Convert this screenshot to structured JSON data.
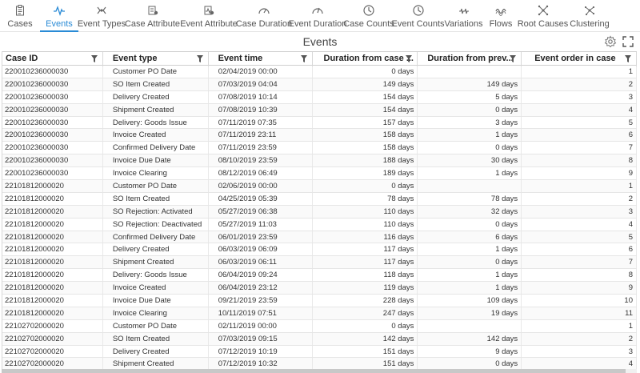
{
  "tabs": [
    {
      "label": "Cases",
      "icon": "clipboard-icon",
      "active": false
    },
    {
      "label": "Events",
      "icon": "pulse-icon",
      "active": true
    },
    {
      "label": "Event Types",
      "icon": "event-types-icon",
      "active": false
    },
    {
      "label": "Case Attribute",
      "icon": "case-attribute-icon",
      "active": false
    },
    {
      "label": "Event Attribute",
      "icon": "event-attribute-icon",
      "active": false
    },
    {
      "label": "Case Duration",
      "icon": "gauge-icon",
      "active": false
    },
    {
      "label": "Event Duration",
      "icon": "gauge-icon",
      "active": false
    },
    {
      "label": "Case Counts",
      "icon": "clock-icon",
      "active": false
    },
    {
      "label": "Event Counts",
      "icon": "clock-icon",
      "active": false
    },
    {
      "label": "Variations",
      "icon": "variations-icon",
      "active": false
    },
    {
      "label": "Flows",
      "icon": "flows-icon",
      "active": false
    },
    {
      "label": "Root Causes",
      "icon": "root-causes-icon",
      "active": false
    },
    {
      "label": "Clustering",
      "icon": "clustering-icon",
      "active": false
    }
  ],
  "page_title": "Events",
  "columns": [
    "Case ID",
    "Event type",
    "Event time",
    "Duration from case ...",
    "Duration from prev...",
    "Event order in case"
  ],
  "rows": [
    [
      "220010236000030",
      "Customer PO Date",
      "02/04/2019 00:00",
      "0 days",
      "",
      "1"
    ],
    [
      "220010236000030",
      "SO Item Created",
      "07/03/2019 04:04",
      "149 days",
      "149 days",
      "2"
    ],
    [
      "220010236000030",
      "Delivery Created",
      "07/08/2019 10:14",
      "154 days",
      "5 days",
      "3"
    ],
    [
      "220010236000030",
      "Shipment Created",
      "07/08/2019 10:39",
      "154 days",
      "0 days",
      "4"
    ],
    [
      "220010236000030",
      "Delivery: Goods Issue",
      "07/11/2019 07:35",
      "157 days",
      "3 days",
      "5"
    ],
    [
      "220010236000030",
      "Invoice Created",
      "07/11/2019 23:11",
      "158 days",
      "1 days",
      "6"
    ],
    [
      "220010236000030",
      "Confirmed Delivery Date",
      "07/11/2019 23:59",
      "158 days",
      "0 days",
      "7"
    ],
    [
      "220010236000030",
      "Invoice Due Date",
      "08/10/2019 23:59",
      "188 days",
      "30 days",
      "8"
    ],
    [
      "220010236000030",
      "Invoice Clearing",
      "08/12/2019 06:49",
      "189 days",
      "1 days",
      "9"
    ],
    [
      "22101812000020",
      "Customer PO Date",
      "02/06/2019 00:00",
      "0 days",
      "",
      "1"
    ],
    [
      "22101812000020",
      "SO Item Created",
      "04/25/2019 05:39",
      "78 days",
      "78 days",
      "2"
    ],
    [
      "22101812000020",
      "SO Rejection: Activated",
      "05/27/2019 06:38",
      "110 days",
      "32 days",
      "3"
    ],
    [
      "22101812000020",
      "SO Rejection: Deactivated",
      "05/27/2019 11:03",
      "110 days",
      "0 days",
      "4"
    ],
    [
      "22101812000020",
      "Confirmed Delivery Date",
      "06/01/2019 23:59",
      "116 days",
      "6 days",
      "5"
    ],
    [
      "22101812000020",
      "Delivery Created",
      "06/03/2019 06:09",
      "117 days",
      "1 days",
      "6"
    ],
    [
      "22101812000020",
      "Shipment Created",
      "06/03/2019 06:11",
      "117 days",
      "0 days",
      "7"
    ],
    [
      "22101812000020",
      "Delivery: Goods Issue",
      "06/04/2019 09:24",
      "118 days",
      "1 days",
      "8"
    ],
    [
      "22101812000020",
      "Invoice Created",
      "06/04/2019 23:12",
      "119 days",
      "1 days",
      "9"
    ],
    [
      "22101812000020",
      "Invoice Due Date",
      "09/21/2019 23:59",
      "228 days",
      "109 days",
      "10"
    ],
    [
      "22101812000020",
      "Invoice Clearing",
      "10/11/2019 07:51",
      "247 days",
      "19 days",
      "11"
    ],
    [
      "22102702000020",
      "Customer PO Date",
      "02/11/2019 00:00",
      "0 days",
      "",
      "1"
    ],
    [
      "22102702000020",
      "SO Item Created",
      "07/03/2019 09:15",
      "142 days",
      "142 days",
      "2"
    ],
    [
      "22102702000020",
      "Delivery Created",
      "07/12/2019 10:19",
      "151 days",
      "9 days",
      "3"
    ],
    [
      "22102702000020",
      "Shipment Created",
      "07/12/2019 10:32",
      "151 days",
      "0 days",
      "4"
    ],
    [
      "22102702000020",
      "Delivery: Goods Issue",
      "07/12/2019 10:35",
      "151 days",
      "0 days",
      "5"
    ]
  ],
  "colors": {
    "accent": "#2a8bd6",
    "border": "#d8d8d8"
  }
}
